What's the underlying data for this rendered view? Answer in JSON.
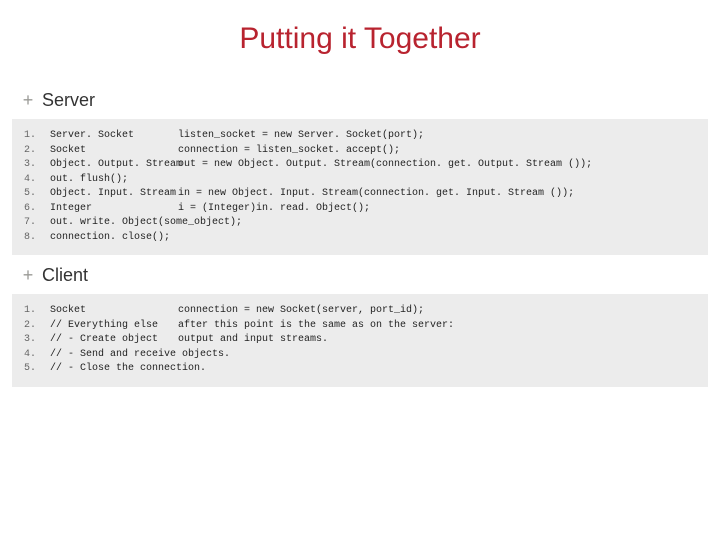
{
  "title": "Putting it Together",
  "bullet": "+",
  "sections": {
    "server": {
      "label": "Server",
      "lines": {
        "l1": {
          "n": "1.",
          "c1": "Server. Socket",
          "c2": "listen_socket = new Server. Socket(port);"
        },
        "l2": {
          "n": "2.",
          "c1": "Socket",
          "c2": "connection = listen_socket. accept();"
        },
        "l3": {
          "n": "3.",
          "c1": "Object. Output. Stream",
          "c2": "out = new Object. Output. Stream(connection. get. Output. Stream ());"
        },
        "l4": {
          "n": "4.",
          "c1": "out. flush();",
          "c2": ""
        },
        "l5": {
          "n": "5.",
          "c1": "Object. Input. Stream",
          "c2": "in = new Object. Input. Stream(connection. get. Input. Stream ());"
        },
        "l6": {
          "n": "6.",
          "c1": "Integer",
          "c2": "i = (Integer)in. read. Object();"
        },
        "l7": {
          "n": "7.",
          "full": "out. write. Object(some_object);"
        },
        "l8": {
          "n": "8.",
          "full": "connection. close();"
        }
      }
    },
    "client": {
      "label": "Client",
      "lines": {
        "l1": {
          "n": "1.",
          "c1": "Socket",
          "c2": "connection = new Socket(server, port_id);"
        },
        "l2": {
          "n": "2.",
          "c1": "// Everything else",
          "c2": "after this point is the same as on the server:"
        },
        "l3": {
          "n": "3.",
          "c1": "// - Create object",
          "c2": "output and input streams."
        },
        "l4": {
          "n": "4.",
          "full": "// - Send and receive objects."
        },
        "l5": {
          "n": "5.",
          "full": "// - Close the connection."
        }
      }
    }
  },
  "chart_data": {
    "type": "table",
    "title": "Putting it Together",
    "series": [
      {
        "name": "Server",
        "values": [
          "Server. Socket        listen_socket = new Server. Socket(port);",
          "Socket                connection = listen_socket. accept();",
          "Object. Output. Stream out = new Object. Output. Stream(connection. get. Output. Stream ());",
          "out. flush();",
          "Object. Input. Stream  in = new Object. Input. Stream(connection. get. Input. Stream ());",
          "Integer               i = (Integer)in. read. Object();",
          "out. write. Object(some_object);",
          "connection. close();"
        ]
      },
      {
        "name": "Client",
        "values": [
          "Socket                connection = new Socket(server, port_id);",
          "// Everything else after this point is the same as on the server:",
          "// - Create object output and input streams.",
          "// - Send and receive objects.",
          "// - Close the connection."
        ]
      }
    ]
  }
}
